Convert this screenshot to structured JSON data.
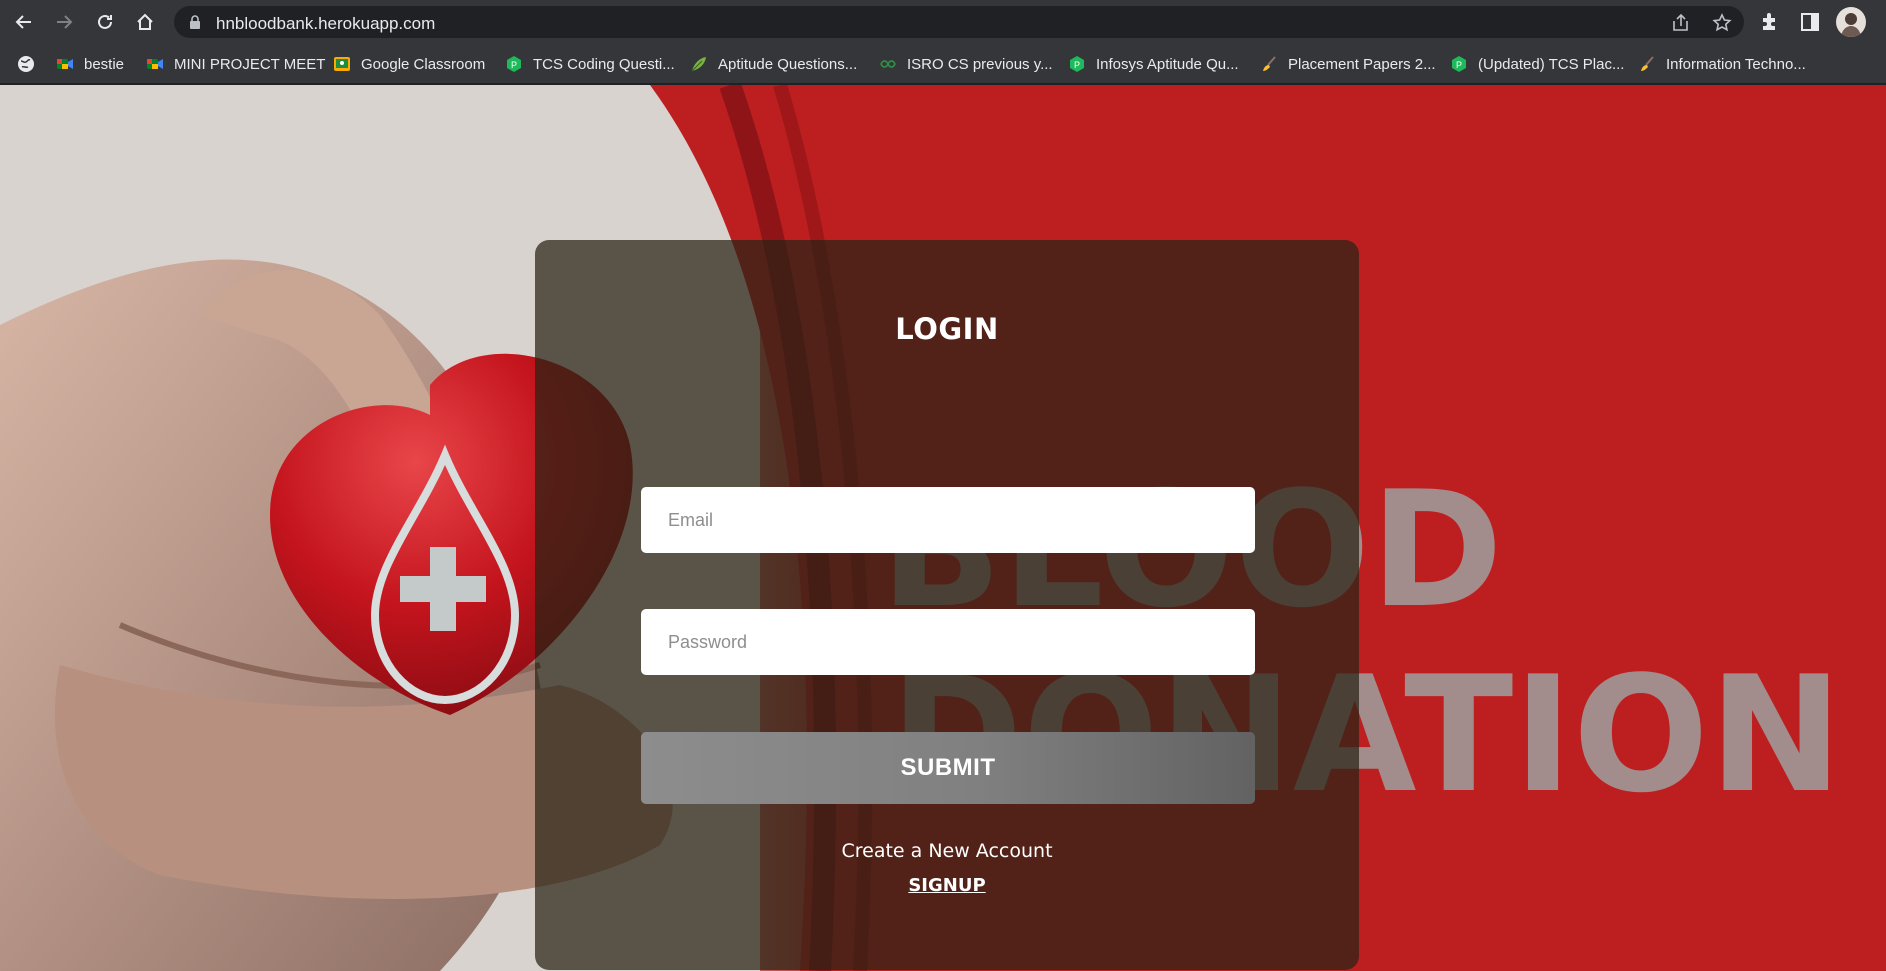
{
  "browser": {
    "url": "hnbloodbank.herokuapp.com",
    "bookmarks": [
      {
        "label": "bestie",
        "icon": "meet-icon"
      },
      {
        "label": "MINI PROJECT MEET",
        "icon": "meet-icon"
      },
      {
        "label": "Google Classroom",
        "icon": "classroom-icon"
      },
      {
        "label": "TCS Coding Questi...",
        "icon": "prepinsta-icon"
      },
      {
        "label": "Aptitude Questions...",
        "icon": "leaf-icon"
      },
      {
        "label": "ISRO CS previous y...",
        "icon": "geeks-icon"
      },
      {
        "label": "Infosys Aptitude Qu...",
        "icon": "prepinsta-icon"
      },
      {
        "label": "Placement Papers 2...",
        "icon": "broom-icon"
      },
      {
        "label": "(Updated) TCS Plac...",
        "icon": "prepinsta-icon"
      },
      {
        "label": "Information Techno...",
        "icon": "broom-icon"
      }
    ]
  },
  "background": {
    "word1": "BLOOD",
    "word2": "DONATION"
  },
  "login": {
    "title": "LOGIN",
    "email_placeholder": "Email",
    "password_placeholder": "Password",
    "submit_label": "SUBMIT",
    "create_text": "Create a New Account",
    "signup_label": "SIGNUP"
  },
  "colors": {
    "chrome": "#35363a",
    "omnibox": "#202124",
    "accent_red": "#c0201f",
    "card": "rgba(40,35,20,0.72)"
  }
}
